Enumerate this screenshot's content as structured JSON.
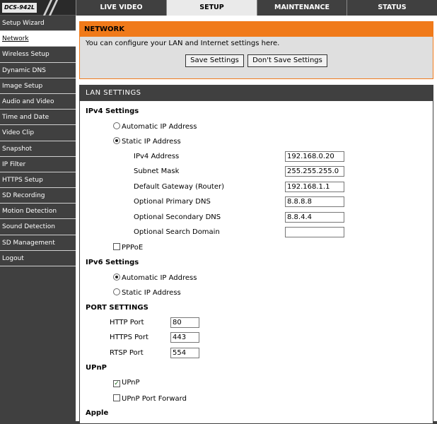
{
  "app": {
    "model": "DCS-942L"
  },
  "tabs": [
    {
      "label": "LIVE VIDEO",
      "active": false
    },
    {
      "label": "SETUP",
      "active": true
    },
    {
      "label": "MAINTENANCE",
      "active": false
    },
    {
      "label": "STATUS",
      "active": false
    }
  ],
  "sidebar": {
    "items": [
      {
        "label": "Setup Wizard",
        "active": false
      },
      {
        "label": "Network",
        "active": true
      },
      {
        "label": "Wireless Setup",
        "active": false
      },
      {
        "label": "Dynamic DNS",
        "active": false
      },
      {
        "label": "Image Setup",
        "active": false
      },
      {
        "label": "Audio and Video",
        "active": false
      },
      {
        "label": "Time and Date",
        "active": false
      },
      {
        "label": "Video Clip",
        "active": false
      },
      {
        "label": "Snapshot",
        "active": false
      },
      {
        "label": "IP Filter",
        "active": false
      },
      {
        "label": "HTTPS Setup",
        "active": false
      },
      {
        "label": "SD Recording",
        "active": false
      },
      {
        "label": "Motion Detection",
        "active": false
      },
      {
        "label": "Sound Detection",
        "active": false
      },
      {
        "label": "SD Management",
        "active": false
      },
      {
        "label": "Logout",
        "active": false
      }
    ]
  },
  "network": {
    "title": "NETWORK",
    "description": "You can configure your LAN and Internet settings here.",
    "save_label": "Save Settings",
    "dont_save_label": "Don't Save Settings"
  },
  "lan": {
    "title": "LAN SETTINGS",
    "ipv4": {
      "header": "IPv4 Settings",
      "auto_label": "Automatic IP Address",
      "static_label": "Static IP Address",
      "selected": "static",
      "fields": {
        "ipv4_address": {
          "label": "IPv4 Address",
          "value": "192.168.0.20"
        },
        "subnet_mask": {
          "label": "Subnet Mask",
          "value": "255.255.255.0"
        },
        "gateway": {
          "label": "Default Gateway (Router)",
          "value": "192.168.1.1"
        },
        "primary_dns": {
          "label": "Optional Primary DNS",
          "value": "8.8.8.8"
        },
        "secondary_dns": {
          "label": "Optional Secondary DNS",
          "value": "8.8.4.4"
        },
        "search_domain": {
          "label": "Optional Search Domain",
          "value": ""
        }
      },
      "pppoe_label": "PPPoE",
      "pppoe_checked": false
    },
    "ipv6": {
      "header": "IPv6 Settings",
      "auto_label": "Automatic IP Address",
      "static_label": "Static IP Address",
      "selected": "auto"
    },
    "ports": {
      "header": "PORT SETTINGS",
      "http_label": "HTTP Port",
      "http_value": "80",
      "https_label": "HTTPS Port",
      "https_value": "443",
      "rtsp_label": "RTSP Port",
      "rtsp_value": "554"
    },
    "upnp": {
      "header": "UPnP",
      "upnp_label": "UPnP",
      "upnp_checked": true,
      "forward_label": "UPnP Port Forward",
      "forward_checked": false
    },
    "apple": {
      "header": "Apple"
    }
  },
  "colors": {
    "accent_orange": "#f07a1a",
    "dark_gray": "#404040",
    "check_green": "#1a6a1a"
  }
}
